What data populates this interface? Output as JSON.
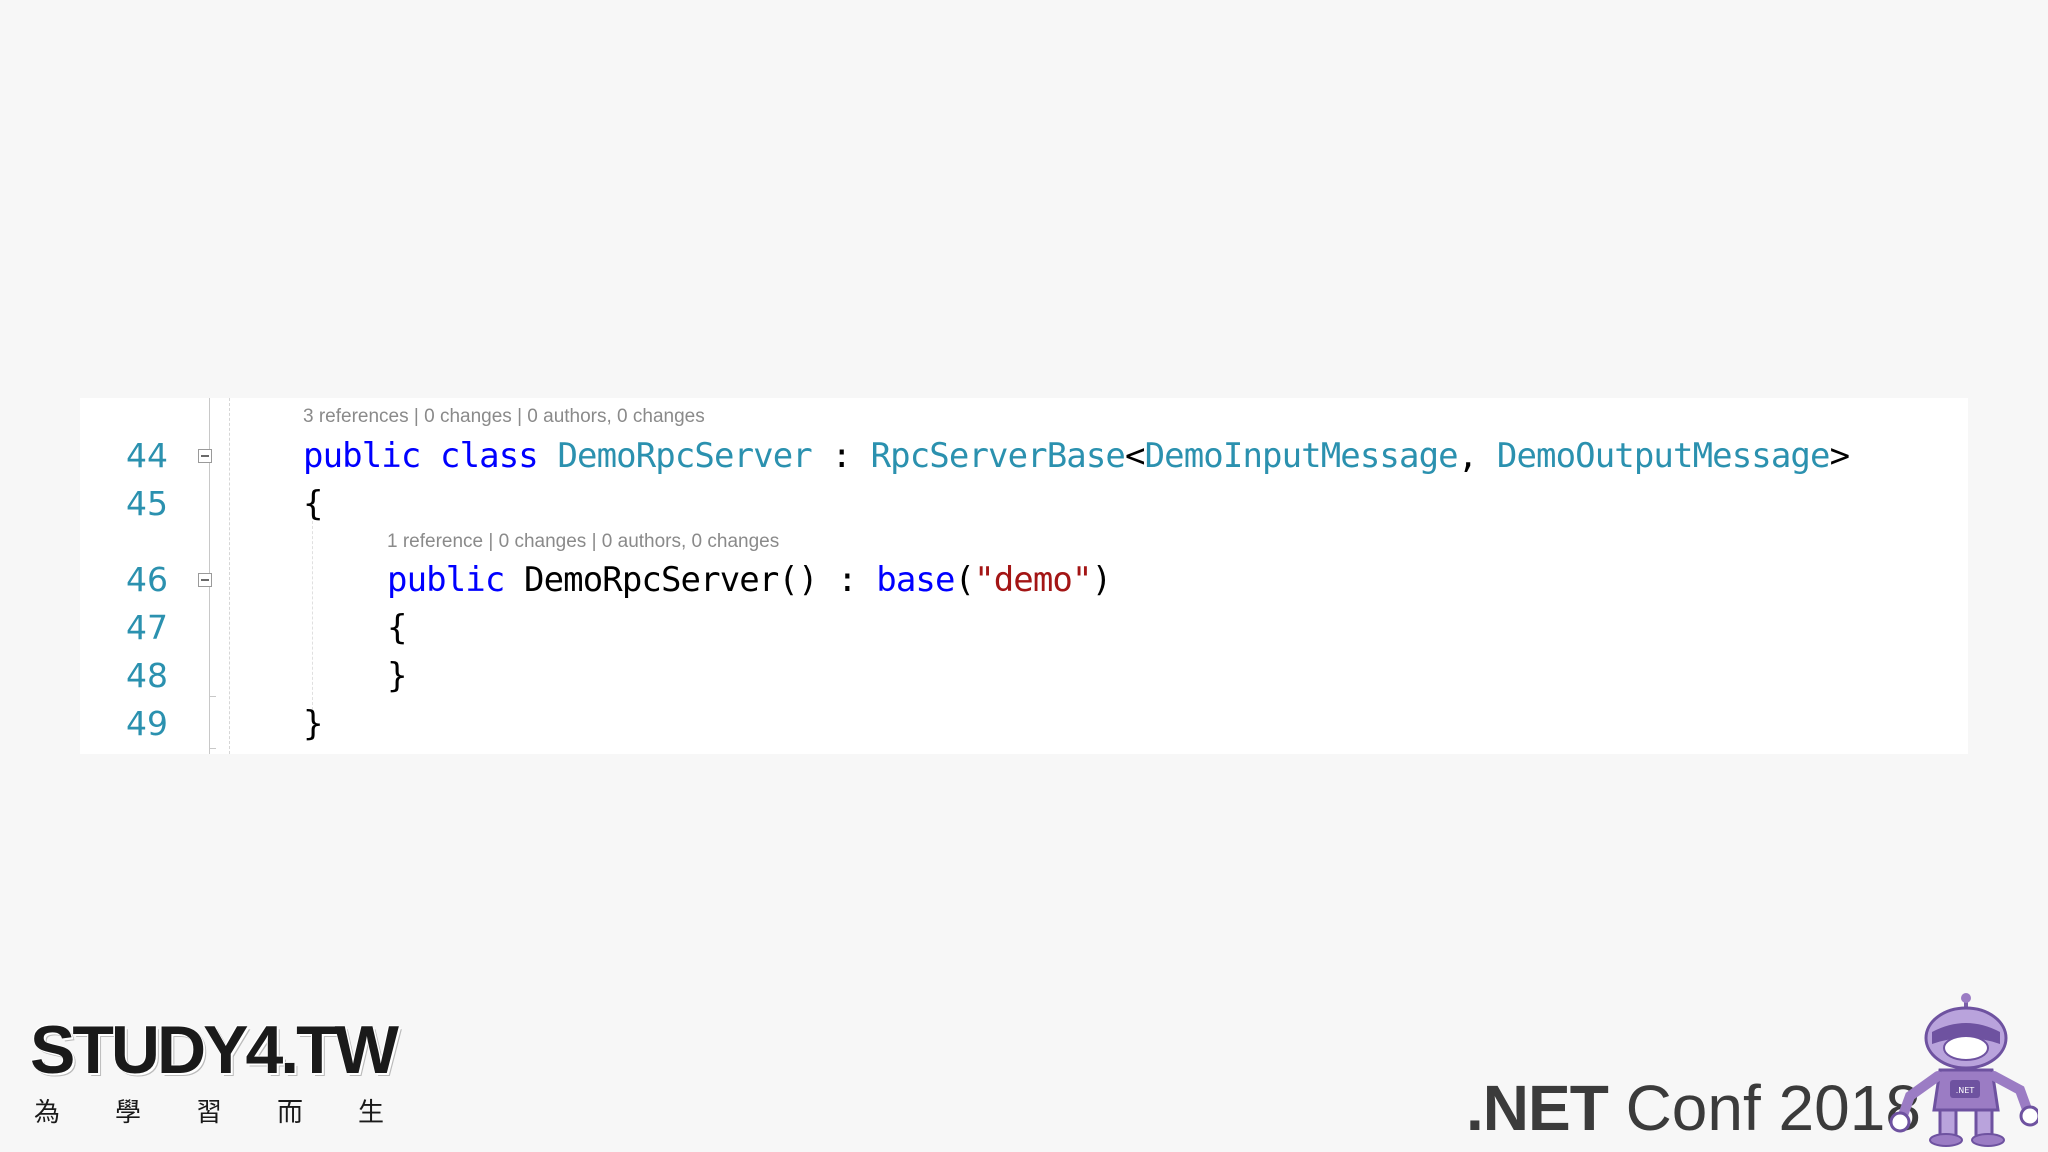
{
  "code_editor": {
    "colors": {
      "background": "#ffffff",
      "line_number": "#2b91af",
      "keyword": "#0000ff",
      "type": "#2b91af",
      "string": "#a31515",
      "codelens": "#8a8a8a"
    },
    "codelens": [
      "3 references | 0 changes | 0 authors, 0 changes",
      "1 reference | 0 changes | 0 authors, 0 changes"
    ],
    "lines": [
      {
        "number": "44",
        "tokens": [
          "public",
          "class",
          "DemoRpcServer",
          ":",
          "RpcServerBase",
          "<",
          "DemoInputMessage",
          ",",
          "DemoOutputMessage",
          ">"
        ]
      },
      {
        "number": "45",
        "tokens": [
          "{"
        ]
      },
      {
        "number": "46",
        "tokens": [
          "public",
          "DemoRpcServer",
          "()",
          ":",
          "base",
          "(",
          "\"demo\"",
          ")"
        ]
      },
      {
        "number": "47",
        "tokens": [
          "{"
        ]
      },
      {
        "number": "48",
        "tokens": [
          "}"
        ]
      },
      {
        "number": "49",
        "tokens": [
          "}"
        ]
      }
    ]
  },
  "branding": {
    "study4": {
      "title": "STUDY4.TW",
      "chars": [
        "為",
        "學",
        "習",
        "而",
        "生"
      ]
    },
    "netconf": {
      "net": ".NET",
      "rest": " Conf 2018"
    },
    "mascot": {
      "icon": "dotnet-bot-mascot-icon",
      "badge": ".NET",
      "color": "#9b7cc4"
    }
  }
}
